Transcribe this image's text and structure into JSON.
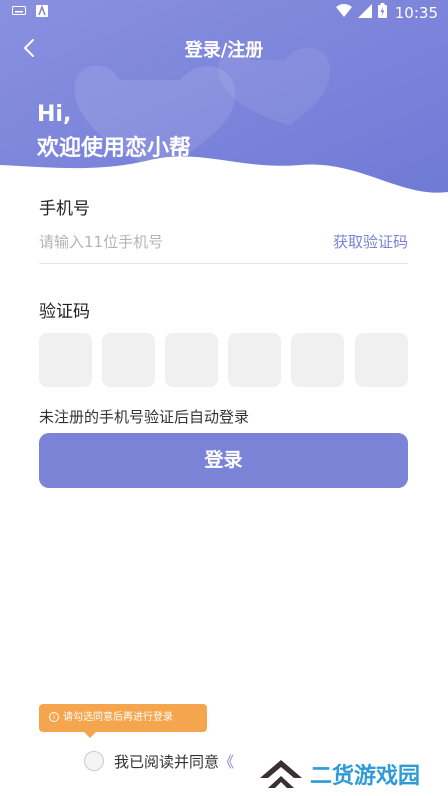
{
  "status_bar": {
    "time": "10:35"
  },
  "nav": {
    "title": "登录/注册"
  },
  "greeting": {
    "hi": "Hi,",
    "welcome": "欢迎使用恋小帮"
  },
  "phone": {
    "label": "手机号",
    "placeholder": "请输入11位手机号",
    "get_code": "获取验证码"
  },
  "verify": {
    "label": "验证码",
    "box_count": 6
  },
  "hint": "未注册的手机号验证后自动登录",
  "login_button": "登录",
  "tooltip": "请勾选同意后再进行登录",
  "agreement": {
    "text": "我已阅读并同意",
    "link": "《"
  },
  "watermark": {
    "text": "二货游戏园"
  },
  "colors": {
    "accent": "#7b83d6",
    "header_gradient_start": "#8a90e0",
    "header_gradient_end": "#6f7ad6",
    "tooltip": "#f5a54e",
    "code_box": "#f0f0f0"
  }
}
